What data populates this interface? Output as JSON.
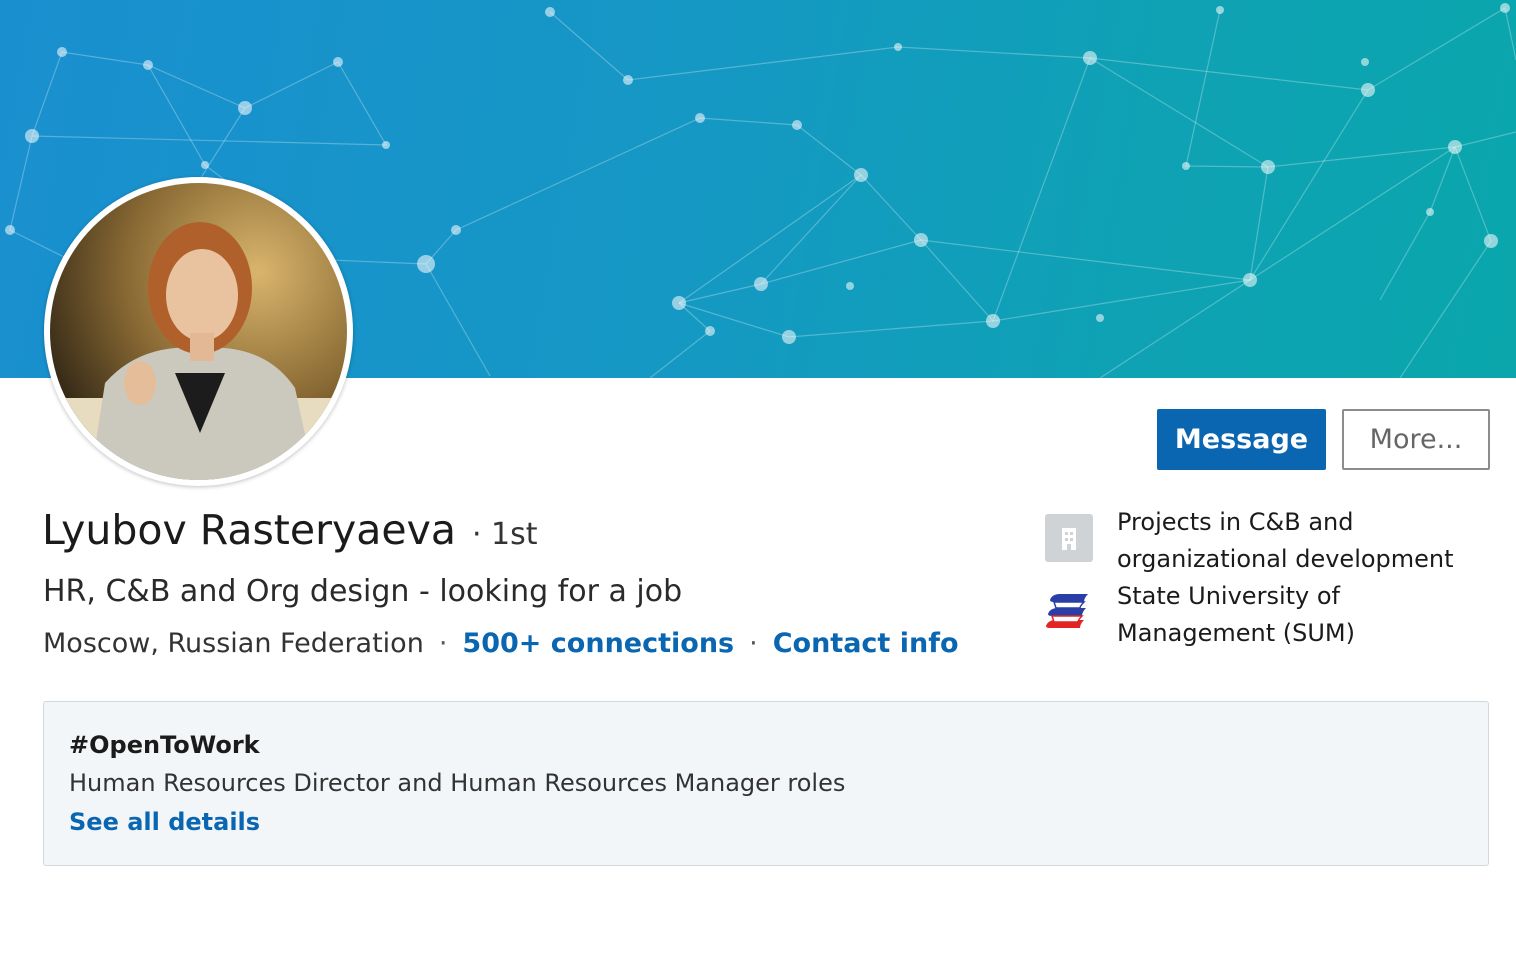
{
  "profile": {
    "name": "Lyubov Rasteryaeva",
    "degree": "· 1st",
    "headline": "HR, C&B and Org design - looking for a job",
    "location": "Moscow, Russian Federation",
    "separator": "·",
    "connections": "500+ connections",
    "contact_info": "Contact info"
  },
  "actions": {
    "message_label": "Message",
    "more_label": "More..."
  },
  "sidebar": {
    "experience": {
      "title_line1": "Projects in C&B and",
      "title_line2": "organizational development",
      "icon": "building-icon"
    },
    "education": {
      "title_line1": "State University of",
      "title_line2": "Management (SUM)",
      "icon": "school-logo-icon"
    }
  },
  "open_to_work": {
    "title": "#OpenToWork",
    "description": "Human Resources Director and Human Resources Manager roles",
    "link": "See all details"
  },
  "colors": {
    "accent": "#0a66b0",
    "banner_start": "#1a8fd0",
    "banner_end": "#0aa6ac"
  }
}
